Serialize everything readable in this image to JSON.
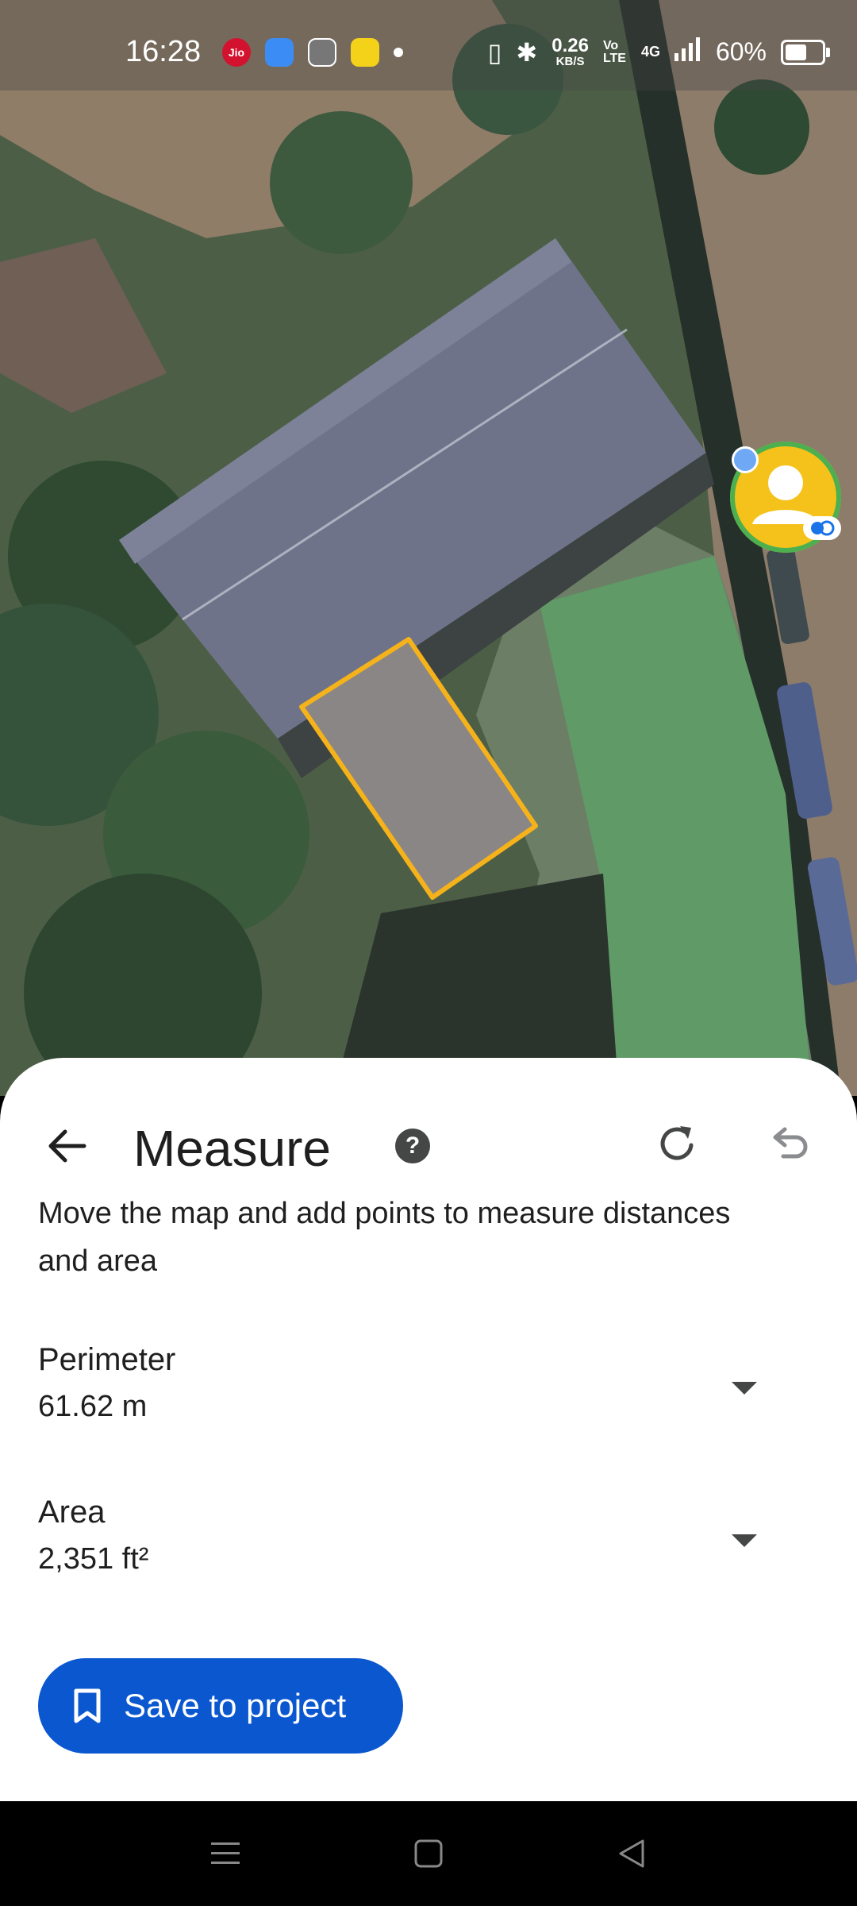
{
  "status_bar": {
    "time": "16:28",
    "carrier_badge": "Jio",
    "net_speed_value": "0.26",
    "net_speed_unit": "KB/S",
    "volte_label": "Vo LTE",
    "network_type": "4G",
    "battery_text": "60%",
    "battery_level": 0.6
  },
  "sheet": {
    "title": "Measure",
    "help_icon_glyph": "?",
    "instructions": "Move the map and add points to measure distances and area",
    "perimeter": {
      "label": "Perimeter",
      "value": "61.62 m"
    },
    "area": {
      "label": "Area",
      "value": "2,351 ft²"
    },
    "save_button_label": "Save to project"
  },
  "icons": {
    "back": "arrow-back-icon",
    "help": "help-icon",
    "redo": "redo-icon",
    "undo": "undo-icon",
    "expand": "chevron-down-icon",
    "bookmark": "bookmark-icon"
  },
  "colors": {
    "accent": "#0b57d0",
    "polygon_outline": "#f5b21a",
    "sheet_bg": "#ffffff",
    "text": "#1f1f1f",
    "avatar": "#f4c21a"
  }
}
